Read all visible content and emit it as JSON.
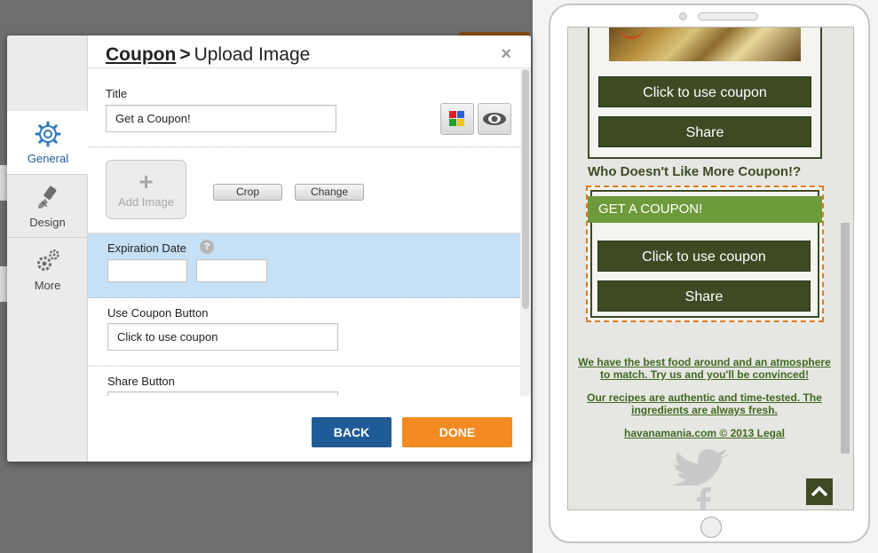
{
  "modal": {
    "breadcrumb_link": "Coupon",
    "breadcrumb_sep": ">",
    "breadcrumb_current": "Upload Image",
    "close_label": "×",
    "nav": [
      {
        "label": "General",
        "icon": "gear-icon",
        "active": true
      },
      {
        "label": "Design",
        "icon": "paintbrush-icon",
        "active": false
      },
      {
        "label": "More",
        "icon": "gears-icon",
        "active": false
      }
    ],
    "form": {
      "title_label": "Title",
      "title_value": "Get a Coupon!",
      "add_image_plus": "+",
      "add_image_label": "Add Image",
      "crop_label": "Crop",
      "change_label": "Change",
      "expiration_label": "Expiration Date",
      "help_glyph": "?",
      "expiration_from_value": "",
      "expiration_to_value": "",
      "use_coupon_label": "Use Coupon Button",
      "use_coupon_value": "Click to use coupon",
      "share_label": "Share Button"
    },
    "footer": {
      "back_label": "BACK",
      "done_label": "DONE"
    }
  },
  "phone": {
    "card1_use_button": "Click to use coupon",
    "card1_share_button": "Share",
    "heading": "Who Doesn't Like More Coupon!?",
    "banner": "GET A COUPON!",
    "card2_use_button": "Click to use coupon",
    "card2_share_button": "Share",
    "footer_line1a": "We have the best food around and an atmosphere",
    "footer_line1b": "to match. Try us and you'll be convinced!",
    "footer_line2a": "Our recipes are authentic and time-tested. The",
    "footer_line2b": "ingredients are always fresh.",
    "footer_links": "havanamania.com  © 2013 Legal"
  },
  "colors": {
    "accent_blue": "#1f5b96",
    "accent_orange": "#f48a22",
    "theme_green_dark": "#3e4a24",
    "theme_green_light": "#6d9a3a"
  }
}
